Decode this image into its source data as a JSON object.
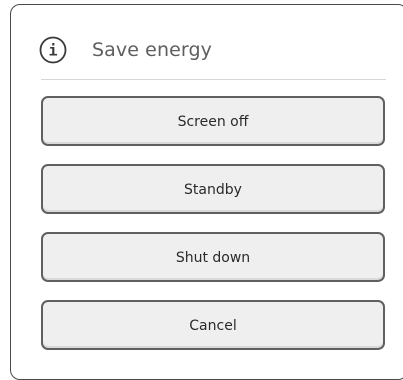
{
  "dialog": {
    "icon": "info-icon",
    "title": "Save energy"
  },
  "buttons": {
    "screen_off": "Screen off",
    "standby": "Standby",
    "shut_down": "Shut down",
    "cancel": "Cancel"
  },
  "colors": {
    "border": "#4a4a4a",
    "button_fill": "#efefef",
    "button_border": "#606060",
    "title_text": "#5e5e5e",
    "divider": "#d6d6d6"
  }
}
